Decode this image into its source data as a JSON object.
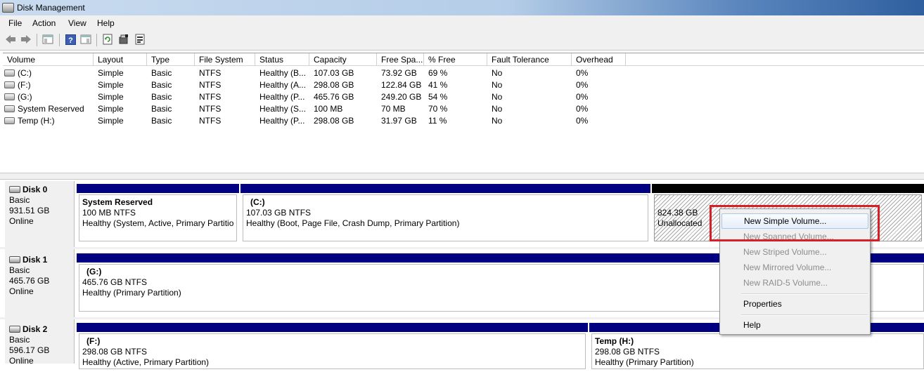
{
  "window": {
    "title": "Disk Management"
  },
  "menu": [
    "File",
    "Action",
    "View",
    "Help"
  ],
  "toolbar": {
    "icons": [
      "back-arrow-icon",
      "forward-arrow-icon",
      "console-tree-icon",
      "help-icon",
      "show-hide-icon",
      "refresh-icon",
      "rescan-icon",
      "properties-icon"
    ]
  },
  "volume_list": {
    "columns": [
      "Volume",
      "Layout",
      "Type",
      "File System",
      "Status",
      "Capacity",
      "Free Spa...",
      "% Free",
      "Fault Tolerance",
      "Overhead"
    ],
    "rows": [
      [
        "(C:)",
        "Simple",
        "Basic",
        "NTFS",
        "Healthy (B...",
        "107.03 GB",
        "73.92 GB",
        "69 %",
        "No",
        "0%"
      ],
      [
        "(F:)",
        "Simple",
        "Basic",
        "NTFS",
        "Healthy (A...",
        "298.08 GB",
        "122.84 GB",
        "41 %",
        "No",
        "0%"
      ],
      [
        "(G:)",
        "Simple",
        "Basic",
        "NTFS",
        "Healthy (P...",
        "465.76 GB",
        "249.20 GB",
        "54 %",
        "No",
        "0%"
      ],
      [
        "System Reserved",
        "Simple",
        "Basic",
        "NTFS",
        "Healthy (S...",
        "100 MB",
        "70 MB",
        "70 %",
        "No",
        "0%"
      ],
      [
        "Temp (H:)",
        "Simple",
        "Basic",
        "NTFS",
        "Healthy (P...",
        "298.08 GB",
        "31.97 GB",
        "11 %",
        "No",
        "0%"
      ]
    ]
  },
  "disks": [
    {
      "name": "Disk 0",
      "type": "Basic",
      "size": "931.51 GB",
      "status": "Online",
      "partitions": [
        {
          "name": "System Reserved",
          "size": "100 MB NTFS",
          "status": "Healthy (System, Active, Primary Partition)"
        },
        {
          "name": "(C:)",
          "size": "107.03 GB NTFS",
          "status": "Healthy (Boot, Page File, Crash Dump, Primary Partition)"
        },
        {
          "name": "",
          "size": "824.38 GB",
          "status": "Unallocated"
        }
      ]
    },
    {
      "name": "Disk 1",
      "type": "Basic",
      "size": "465.76 GB",
      "status": "Online",
      "partitions": [
        {
          "name": "(G:)",
          "size": "465.76 GB NTFS",
          "status": "Healthy (Primary Partition)"
        }
      ]
    },
    {
      "name": "Disk 2",
      "type": "Basic",
      "size": "596.17 GB",
      "status": "Online",
      "partitions": [
        {
          "name": "(F:)",
          "size": "298.08 GB NTFS",
          "status": "Healthy (Active, Primary Partition)"
        },
        {
          "name": "Temp  (H:)",
          "size": "298.08 GB NTFS",
          "status": "Healthy (Primary Partition)"
        }
      ]
    }
  ],
  "context_menu": {
    "items": [
      {
        "label": "New Simple Volume...",
        "enabled": true,
        "highlighted": true
      },
      {
        "label": "New Spanned Volume...",
        "enabled": false
      },
      {
        "label": "New Striped Volume...",
        "enabled": false
      },
      {
        "label": "New Mirrored Volume...",
        "enabled": false
      },
      {
        "label": "New RAID-5 Volume...",
        "enabled": false
      },
      {
        "label": "Properties",
        "enabled": true
      },
      {
        "label": "Help",
        "enabled": true
      }
    ]
  },
  "colors": {
    "partition_bar": "#000080",
    "unallocated_bar": "#000000",
    "highlight_box": "#d61f26"
  }
}
